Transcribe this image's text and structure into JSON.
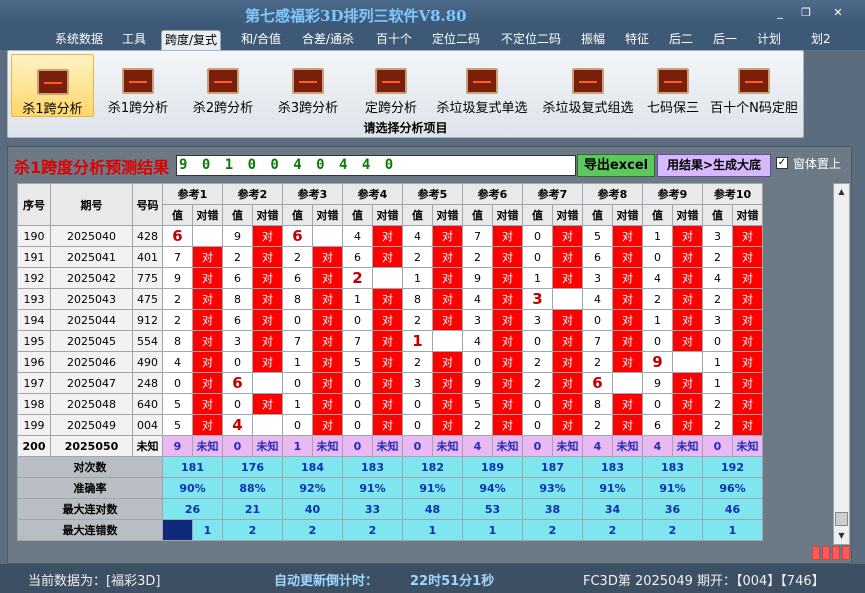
{
  "app": {
    "title": "第七感福彩3D排列三软件V8.80"
  },
  "window_controls": {
    "minimize": "_",
    "maximize": "❐",
    "close": "✕"
  },
  "menu": [
    "系统数据",
    "工具",
    "跨度/复式",
    "和/合值",
    "合差/通杀",
    "百十个",
    "定位二码",
    "不定位二码",
    "振幅",
    "特征",
    "后二",
    "后一",
    "计划",
    "划2"
  ],
  "ribbon": {
    "buttons": [
      "杀1跨分析",
      "杀1跨分析",
      "杀2跨分析",
      "杀3跨分析",
      "定跨分析",
      "杀垃圾复式单选",
      "杀垃圾复式组选",
      "七码保三",
      "百十个N码定胆"
    ],
    "caption": "请选择分析项目",
    "icon": "chart-icon"
  },
  "result": {
    "label": "杀1跨度分析预测结果",
    "value": "9 0 1 0 0 4 0 4 4 0",
    "export_button": "导出excel",
    "generate_button": "用结果>生成大底",
    "pin_checked": "✓",
    "pin_label": "窗体置上"
  },
  "table": {
    "h_seq": "序号",
    "h_issue": "期号",
    "h_num": "号码",
    "ref_headers": [
      "参考1",
      "参考2",
      "参考3",
      "参考4",
      "参考5",
      "参考6",
      "参考7",
      "参考8",
      "参考9",
      "参考10"
    ],
    "sub_val": "值",
    "sub_ok": "对错",
    "ok_mark": "对",
    "rows": [
      {
        "seq": "190",
        "issue": "2025040",
        "num": "428",
        "vals": [
          "6",
          "9",
          "6",
          "4",
          "4",
          "7",
          "0",
          "5",
          "1",
          "3"
        ],
        "ok": [
          false,
          true,
          false,
          true,
          true,
          true,
          true,
          true,
          true,
          true
        ]
      },
      {
        "seq": "191",
        "issue": "2025041",
        "num": "401",
        "vals": [
          "7",
          "2",
          "2",
          "6",
          "2",
          "2",
          "0",
          "6",
          "0",
          "2"
        ],
        "ok": [
          true,
          true,
          true,
          true,
          true,
          true,
          true,
          true,
          true,
          true
        ]
      },
      {
        "seq": "192",
        "issue": "2025042",
        "num": "775",
        "vals": [
          "9",
          "6",
          "6",
          "2",
          "1",
          "9",
          "1",
          "3",
          "4",
          "4"
        ],
        "ok": [
          true,
          true,
          true,
          false,
          true,
          true,
          true,
          true,
          true,
          true
        ]
      },
      {
        "seq": "193",
        "issue": "2025043",
        "num": "475",
        "vals": [
          "2",
          "8",
          "8",
          "1",
          "8",
          "4",
          "3",
          "4",
          "2",
          "2"
        ],
        "ok": [
          true,
          true,
          true,
          true,
          true,
          true,
          false,
          true,
          true,
          true
        ]
      },
      {
        "seq": "194",
        "issue": "2025044",
        "num": "912",
        "vals": [
          "2",
          "6",
          "0",
          "0",
          "2",
          "3",
          "3",
          "0",
          "1",
          "3"
        ],
        "ok": [
          true,
          true,
          true,
          true,
          true,
          true,
          true,
          true,
          true,
          true
        ]
      },
      {
        "seq": "195",
        "issue": "2025045",
        "num": "554",
        "vals": [
          "8",
          "3",
          "7",
          "7",
          "1",
          "4",
          "0",
          "7",
          "0",
          "0"
        ],
        "ok": [
          true,
          true,
          true,
          true,
          false,
          true,
          true,
          true,
          true,
          true
        ]
      },
      {
        "seq": "196",
        "issue": "2025046",
        "num": "490",
        "vals": [
          "4",
          "0",
          "1",
          "5",
          "2",
          "0",
          "2",
          "2",
          "9",
          "1"
        ],
        "ok": [
          true,
          true,
          true,
          true,
          true,
          true,
          true,
          true,
          false,
          true
        ]
      },
      {
        "seq": "197",
        "issue": "2025047",
        "num": "248",
        "vals": [
          "0",
          "6",
          "0",
          "0",
          "3",
          "9",
          "2",
          "6",
          "9",
          "1"
        ],
        "ok": [
          true,
          false,
          true,
          true,
          true,
          true,
          true,
          false,
          true,
          true
        ]
      },
      {
        "seq": "198",
        "issue": "2025048",
        "num": "640",
        "vals": [
          "5",
          "0",
          "1",
          "0",
          "0",
          "5",
          "0",
          "8",
          "0",
          "2"
        ],
        "ok": [
          true,
          true,
          true,
          true,
          true,
          true,
          true,
          true,
          true,
          true
        ]
      },
      {
        "seq": "199",
        "issue": "2025049",
        "num": "004",
        "vals": [
          "5",
          "4",
          "0",
          "0",
          "0",
          "2",
          "0",
          "2",
          "6",
          "2"
        ],
        "ok": [
          true,
          false,
          true,
          true,
          true,
          true,
          true,
          true,
          true,
          true
        ]
      }
    ],
    "unknown_row": {
      "seq": "200",
      "issue": "2025050",
      "num": "未知",
      "vals": [
        "9",
        "0",
        "1",
        "0",
        "0",
        "4",
        "0",
        "4",
        "4",
        "0"
      ],
      "status": "未知"
    },
    "stats": [
      {
        "label": "对次数",
        "values": [
          "181",
          "176",
          "184",
          "183",
          "182",
          "189",
          "187",
          "183",
          "183",
          "192"
        ]
      },
      {
        "label": "准确率",
        "values": [
          "90%",
          "88%",
          "92%",
          "91%",
          "91%",
          "94%",
          "93%",
          "91%",
          "91%",
          "96%"
        ]
      },
      {
        "label": "最大连对数",
        "values": [
          "26",
          "21",
          "40",
          "33",
          "48",
          "53",
          "38",
          "34",
          "36",
          "46"
        ]
      },
      {
        "label": "最大连错数",
        "values": [
          "1",
          "2",
          "2",
          "2",
          "1",
          "1",
          "2",
          "2",
          "2",
          "1"
        ]
      }
    ]
  },
  "status": {
    "current_data": "当前数据为：[福彩3D]",
    "countdown_label": "自动更新倒计时：",
    "countdown_value": "22时51分1秒",
    "issue_info": "FC3D第 2025049 期开：【004】【746】"
  }
}
